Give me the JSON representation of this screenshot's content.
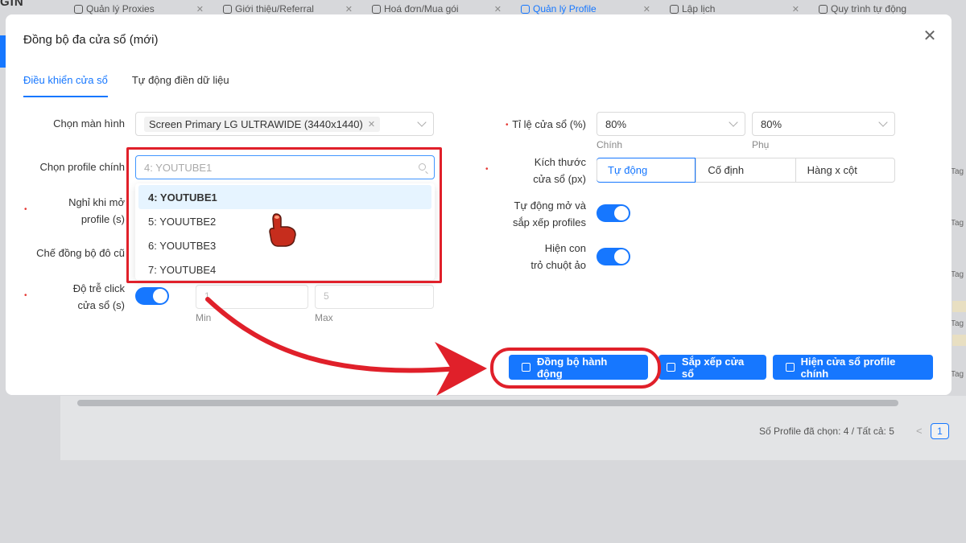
{
  "background": {
    "logo": "GIN",
    "tabs": [
      {
        "label": "Quản lý Proxies",
        "active": false
      },
      {
        "label": "Giới thiệu/Referral",
        "active": false
      },
      {
        "label": "Hoá đơn/Mua gói",
        "active": false
      },
      {
        "label": "Quản lý Profile",
        "active": true
      },
      {
        "label": "Lập lịch",
        "active": false
      },
      {
        "label": "Quy trình tự động",
        "active": false
      }
    ],
    "footer_text": "Số Profile đã chọn: 4 / Tất cả: 5",
    "pager_prev": "<",
    "pager_current": "1",
    "side_tag": "Tag"
  },
  "modal": {
    "title": "Đồng bộ đa cửa sổ (mới)",
    "close": "✕",
    "tabs": [
      {
        "label": "Điều khiển cửa sổ",
        "active": true
      },
      {
        "label": "Tự động điền dữ liệu",
        "active": false
      }
    ],
    "form": {
      "screen_label": "Chọn màn hình",
      "screen_value": "Screen Primary LG ULTRAWIDE (3440x1440)",
      "profile_label": "Chọn profile chính",
      "profile_placeholder": "4: YOUTUBE1",
      "rest_label_1": "Nghỉ khi mở",
      "rest_label_2": "profile (s)",
      "sync_mode_label": "Chế đồng bộ đô cũ",
      "click_delay_label_1": "Độ trễ click",
      "click_delay_label_2": "cửa sổ (s)",
      "delay_min_value": "1",
      "delay_max_value": "5",
      "min_label": "Min",
      "max_label": "Max",
      "ratio_label": "Tỉ lệ cửa sổ (%)",
      "ratio_main_value": "80%",
      "ratio_sub_value": "80%",
      "main_hint": "Chính",
      "sub_hint": "Phụ",
      "size_label_1": "Kích thước",
      "size_label_2": "cửa sổ (px)",
      "size_options": [
        "Tự động",
        "Cố định",
        "Hàng x cột"
      ],
      "size_selected": "Tự động",
      "auto_open_label_1": "Tự động mở và",
      "auto_open_label_2": "sắp xếp profiles",
      "auto_open_on": true,
      "cursor_label_1": "Hiện con",
      "cursor_label_2": "trỏ chuột ảo",
      "cursor_on": true,
      "click_delay_on": true
    },
    "dropdown_options": [
      "4: YOUTUBE1",
      "5: YOUUTBE2",
      "6: YOUUTBE3",
      "7: YOUTUBE4"
    ],
    "dropdown_selected": "4: YOUTUBE1",
    "buttons": {
      "sync_action": "Đồng bộ hành động",
      "arrange_windows": "Sắp xếp cửa sổ",
      "show_main": "Hiện cửa sổ profile chính"
    }
  },
  "colors": {
    "accent": "#1677ff",
    "annotation_red": "#e0202a"
  }
}
